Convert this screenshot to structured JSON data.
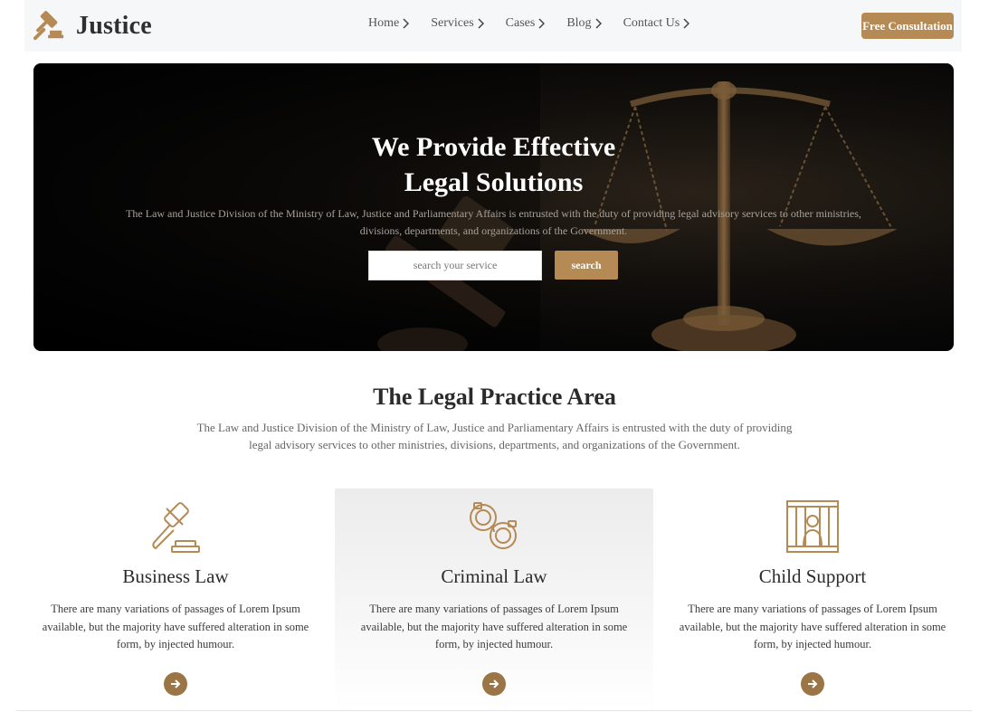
{
  "brand": {
    "name": "Justice",
    "icon": "gavel-icon",
    "accent_color": "#b58a55"
  },
  "nav": {
    "items": [
      {
        "label": "Home"
      },
      {
        "label": "Services"
      },
      {
        "label": "Cases"
      },
      {
        "label": "Blog"
      },
      {
        "label": "Contact Us"
      }
    ],
    "cta_label": "Free Consultation"
  },
  "hero": {
    "title_line1": "We Provide Effective",
    "title_line2": "Legal Solutions",
    "description": "The Law and Justice Division of the Ministry of Law, Justice and Parliamentary Affairs is entrusted with the duty of providing legal advisory services to other ministries, divisions, departments, and organizations of the Government.",
    "search_placeholder": "search your service",
    "search_button": "search"
  },
  "practice": {
    "title": "The Legal Practice Area",
    "description": "The Law and Justice Division of the Ministry of Law, Justice and Parliamentary Affairs is entrusted with the duty of providing legal advisory services to other ministries, divisions, departments, and organizations of the Government.",
    "cards": [
      {
        "title": "Business Law",
        "icon": "gavel-icon",
        "text": "There are many variations of passages of Lorem Ipsum available, but the majority have suffered alteration in some form, by injected humour."
      },
      {
        "title": "Criminal Law",
        "icon": "handcuffs-icon",
        "text": "There are many variations of passages of Lorem Ipsum available, but the majority have suffered alteration in some form, by injected humour."
      },
      {
        "title": "Child Support",
        "icon": "prison-icon",
        "text": "There are many variations of passages of Lorem Ipsum available, but the majority have suffered alteration in some form, by injected humour."
      }
    ],
    "card_button_icon": "arrow-right-icon"
  }
}
